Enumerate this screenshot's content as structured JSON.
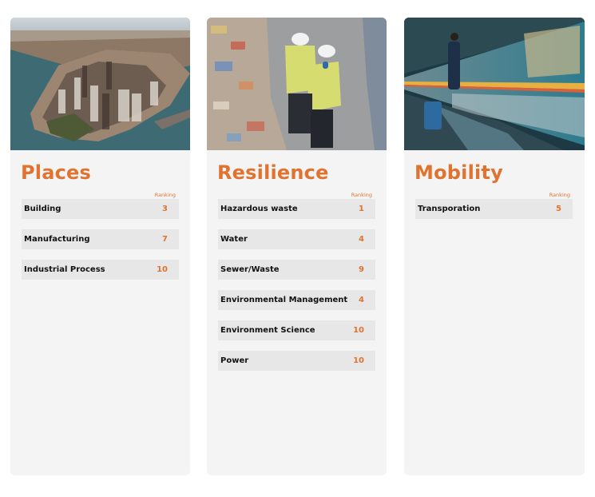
{
  "accent_color": "#e07330",
  "ranking_label": "Ranking",
  "cards": [
    {
      "title": "Places",
      "image": "aerial-city-skyline-image",
      "rows": [
        {
          "name": "Building",
          "rank": "3"
        },
        {
          "name": "Manufacturing",
          "rank": "7"
        },
        {
          "name": "Industrial Process",
          "rank": "10"
        }
      ]
    },
    {
      "title": "Resilience",
      "image": "recycling-workers-image",
      "rows": [
        {
          "name": "Hazardous waste",
          "rank": "1"
        },
        {
          "name": "Water",
          "rank": "4"
        },
        {
          "name": "Sewer/Waste",
          "rank": "9"
        },
        {
          "name": "Environmental Management",
          "rank": "4"
        },
        {
          "name": "Environment Science",
          "rank": "10"
        },
        {
          "name": "Power",
          "rank": "10"
        }
      ]
    },
    {
      "title": "Mobility",
      "image": "train-platform-image",
      "rows": [
        {
          "name": "Transporation",
          "rank": "5"
        }
      ]
    }
  ]
}
